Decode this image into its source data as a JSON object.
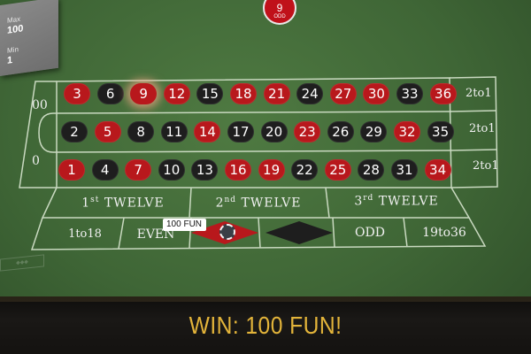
{
  "limits": {
    "max_label": "Max",
    "max_value": "100",
    "min_label": "Min",
    "min_value": "1"
  },
  "last_result": {
    "number": "9",
    "parity": "ODD",
    "color": "#c0111a"
  },
  "zeros": {
    "double_zero": "00",
    "zero": "0"
  },
  "rows": [
    [
      {
        "n": "3",
        "c": "red"
      },
      {
        "n": "6",
        "c": "black"
      },
      {
        "n": "9",
        "c": "red",
        "hl": true
      },
      {
        "n": "12",
        "c": "red"
      },
      {
        "n": "15",
        "c": "black"
      },
      {
        "n": "18",
        "c": "red"
      },
      {
        "n": "21",
        "c": "red"
      },
      {
        "n": "24",
        "c": "black"
      },
      {
        "n": "27",
        "c": "red"
      },
      {
        "n": "30",
        "c": "red"
      },
      {
        "n": "33",
        "c": "black"
      },
      {
        "n": "36",
        "c": "red"
      }
    ],
    [
      {
        "n": "2",
        "c": "black"
      },
      {
        "n": "5",
        "c": "red"
      },
      {
        "n": "8",
        "c": "black"
      },
      {
        "n": "11",
        "c": "black"
      },
      {
        "n": "14",
        "c": "red"
      },
      {
        "n": "17",
        "c": "black"
      },
      {
        "n": "20",
        "c": "black"
      },
      {
        "n": "23",
        "c": "red"
      },
      {
        "n": "26",
        "c": "black"
      },
      {
        "n": "29",
        "c": "black"
      },
      {
        "n": "32",
        "c": "red"
      },
      {
        "n": "35",
        "c": "black"
      }
    ],
    [
      {
        "n": "1",
        "c": "red"
      },
      {
        "n": "4",
        "c": "black"
      },
      {
        "n": "7",
        "c": "red"
      },
      {
        "n": "10",
        "c": "black"
      },
      {
        "n": "13",
        "c": "black"
      },
      {
        "n": "16",
        "c": "red"
      },
      {
        "n": "19",
        "c": "red"
      },
      {
        "n": "22",
        "c": "black"
      },
      {
        "n": "25",
        "c": "red"
      },
      {
        "n": "28",
        "c": "black"
      },
      {
        "n": "31",
        "c": "black"
      },
      {
        "n": "34",
        "c": "red"
      }
    ]
  ],
  "column_bets": [
    "2to1",
    "2to1",
    "2to1"
  ],
  "dozens": [
    {
      "ord": "1",
      "sup": "st",
      "word": "TWELVE"
    },
    {
      "ord": "2",
      "sup": "nd",
      "word": "TWELVE"
    },
    {
      "ord": "3",
      "sup": "rd",
      "word": "TWELVE"
    }
  ],
  "outside": {
    "low": "1to18",
    "even": "EVEN",
    "odd": "ODD",
    "high": "19to36"
  },
  "chip": {
    "label": "100 FUN"
  },
  "win_message": "WIN: 100 FUN!",
  "colors": {
    "red": "#b8181c",
    "black": "#1e1e1e",
    "felt": "#3f6636",
    "win_text": "#e3b43a"
  }
}
